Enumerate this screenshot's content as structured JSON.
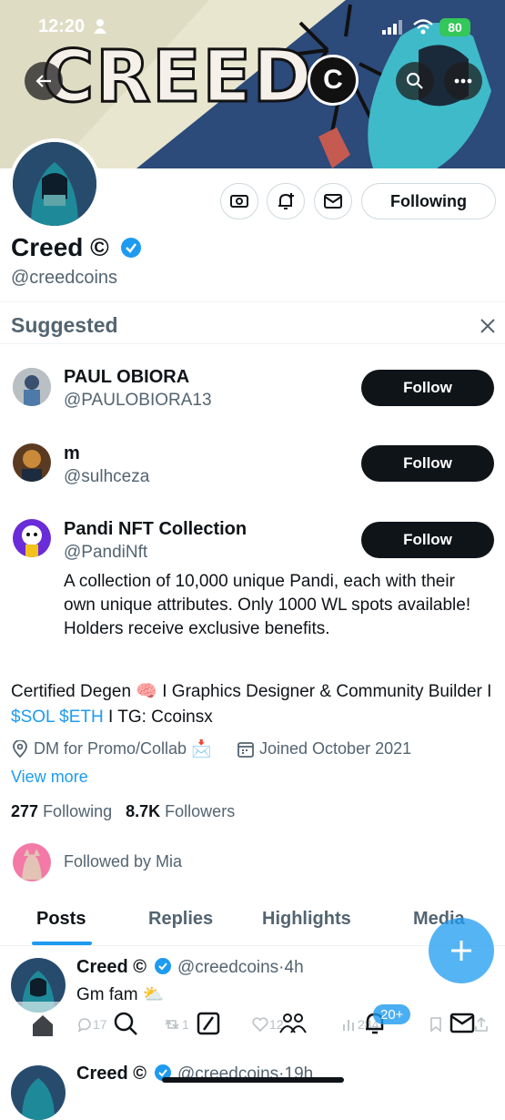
{
  "status_bar": {
    "time": "12:20",
    "battery": "80"
  },
  "banner": {
    "wordmark": "CREED",
    "logo_letter": "C"
  },
  "profile": {
    "name": "Creed ©",
    "handle": "@creedcoins",
    "following_button": "Following",
    "bio_start": "Certified Degen 🧠 I Graphics Designer & Community Builder I ",
    "bio_link": "$SOL $ETH",
    "bio_end": " I TG: Ccoinsx",
    "location": "DM for Promo/Collab 📩",
    "joined": "Joined October 2021",
    "view_more": "View more",
    "following_count": "277",
    "following_label": "Following",
    "followers_count": "8.7K",
    "followers_label": "Followers",
    "followed_by": "Followed by Mia"
  },
  "suggested": {
    "title": "Suggested",
    "follow_label": "Follow",
    "items": [
      {
        "name": "PAUL OBIORA",
        "handle": "@PAULOBIORA13"
      },
      {
        "name": "m",
        "handle": "@sulhceza"
      },
      {
        "name": "Pandi NFT Collection",
        "handle": "@PandiNft",
        "description": "A collection of 10,000 unique Pandi, each with their own unique attributes. Only 1000 WL spots available! Holders receive exclusive benefits."
      }
    ]
  },
  "tabs": [
    "Posts",
    "Replies",
    "Highlights",
    "Media"
  ],
  "posts": [
    {
      "name": "Creed ©",
      "handle": "@creedcoins",
      "time": "4h",
      "text": "Gm fam ⛅",
      "replies": "17",
      "reposts": "1",
      "likes": "12",
      "views": "284"
    },
    {
      "name": "Creed ©",
      "handle": "@creedcoins",
      "time": "19h"
    }
  ],
  "nav": {
    "notifications_badge": "20+"
  },
  "colors": {
    "accent": "#1d9bf0",
    "text": "#0f1419",
    "muted": "#536471"
  }
}
